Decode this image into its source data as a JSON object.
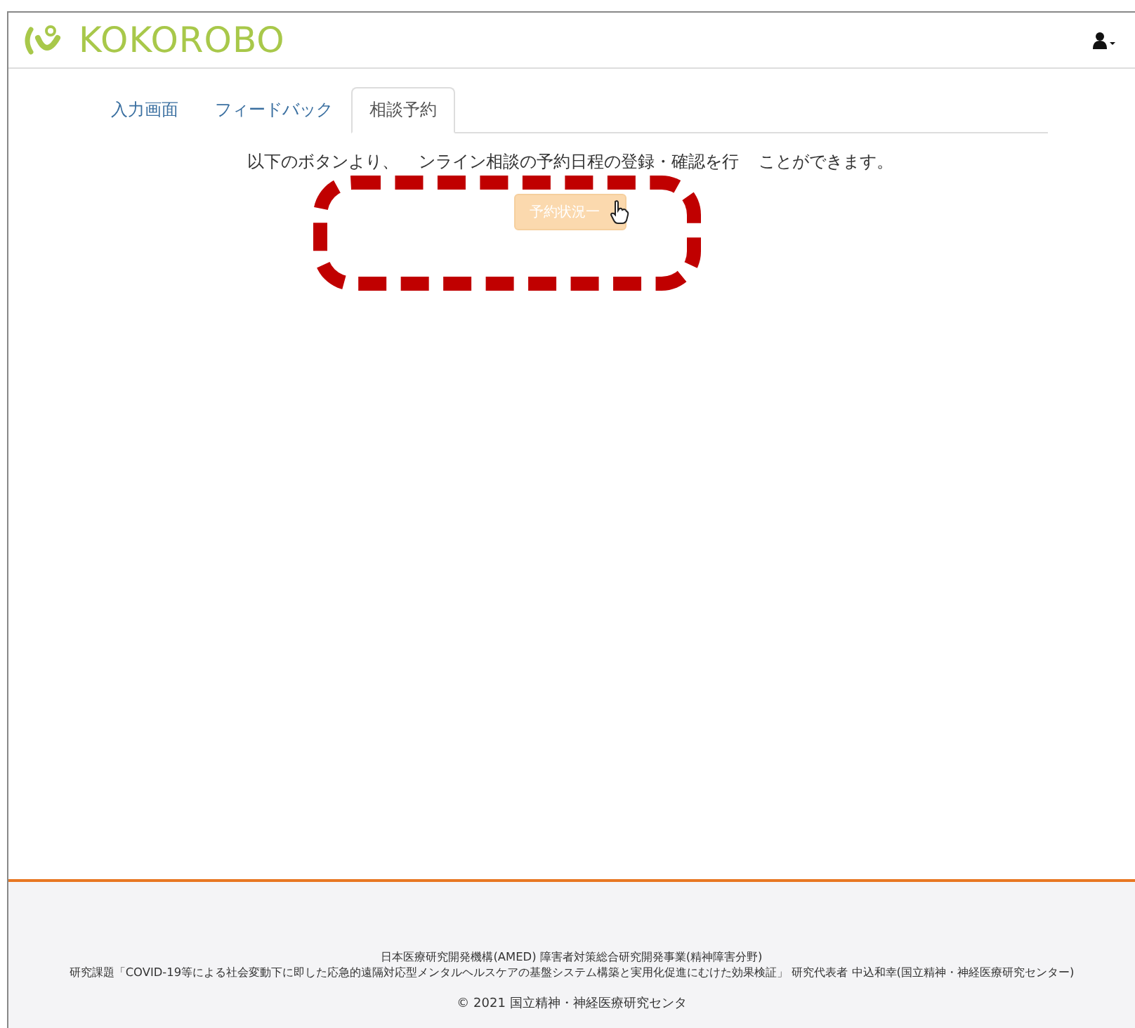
{
  "header": {
    "logo": "KOKOROBO"
  },
  "tabs": [
    {
      "label": "入力画面",
      "selected": false
    },
    {
      "label": "フィードバック",
      "selected": false
    },
    {
      "label": "相談予約",
      "selected": true
    }
  ],
  "intro": [
    "以下のボタンより、",
    "ンライン相談の予約日程の登録・確認を行",
    "ことができます。"
  ],
  "button": {
    "label": "予約状況一",
    "disabled": true
  },
  "footer": {
    "lines": [
      "日本医療研究開発機構(AMED) 障害者対策総合研究開発事業(精神障害分野)",
      "研究課題「COVID-19等による社会変動下に即した応急的遠隔対応型メンタルヘルスケアの基盤システム構築と実用化促進にむけた効果検証」 研究代表者 中込和幸(国立精神・神経医療研究センター)"
    ],
    "copyright": "© 2021 国立精神・神経医療研究センタ"
  }
}
